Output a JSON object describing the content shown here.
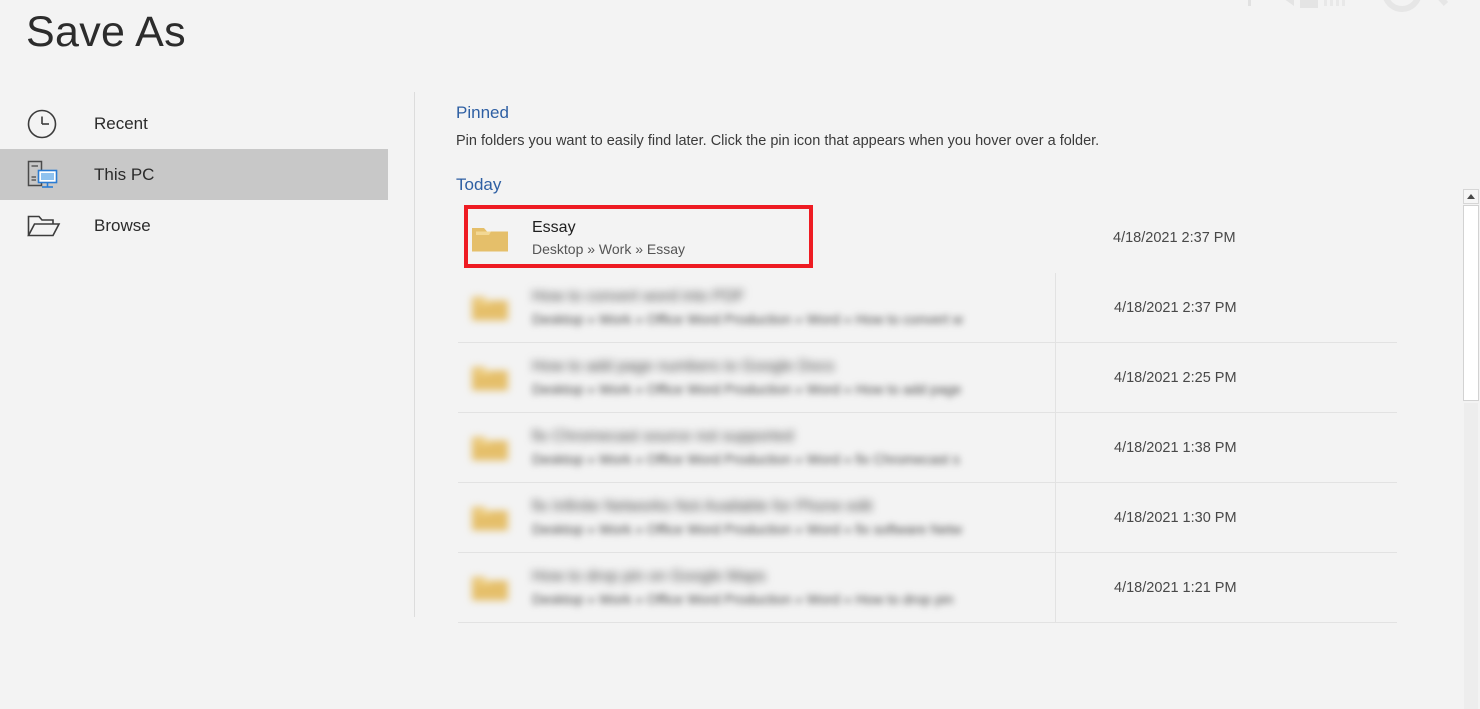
{
  "window": {
    "title": "Save As"
  },
  "topright": {
    "icons": [
      "ribbon-glyph-partial",
      "ribbon-glyph-partial-2",
      "search-glyph-partial"
    ]
  },
  "nav": {
    "items": [
      {
        "label": "Recent",
        "icon": "clock-icon",
        "selected": false
      },
      {
        "label": "This PC",
        "icon": "this-pc-icon",
        "selected": true
      },
      {
        "label": "Browse",
        "icon": "open-folder-icon",
        "selected": false
      }
    ]
  },
  "content": {
    "pinned": {
      "heading": "Pinned",
      "description": "Pin folders you want to easily find later. Click the pin icon that appears when you hover over a folder."
    },
    "today": {
      "heading": "Today"
    },
    "rows": [
      {
        "name": "Essay",
        "path": "Desktop » Work » Essay",
        "date": "4/18/2021 2:37 PM",
        "obscured": false,
        "highlighted": true
      },
      {
        "name": "How to convert word into PDF",
        "path": "Desktop » Work » Office Word Production » Word » How to convert w",
        "date": "4/18/2021 2:37 PM",
        "obscured": true,
        "highlighted": false
      },
      {
        "name": "How to add page numbers to Google Docs",
        "path": "Desktop » Work » Office Word Production » Word » How to add page",
        "date": "4/18/2021 2:25 PM",
        "obscured": true,
        "highlighted": false
      },
      {
        "name": "fix Chromecast source not supported",
        "path": "Desktop » Work » Office Word Production » Word » fix Chromecast s",
        "date": "4/18/2021 1:38 PM",
        "obscured": true,
        "highlighted": false
      },
      {
        "name": "fix Infinite Networks Not Available for Phone edit",
        "path": "Desktop » Work » Office Word Production » Word » fix software Netw",
        "date": "4/18/2021 1:30 PM",
        "obscured": true,
        "highlighted": false
      },
      {
        "name": "How to drop pin on Google Maps",
        "path": "Desktop » Work » Office Word Production » Word » How to drop pin",
        "date": "4/18/2021 1:21 PM",
        "obscured": true,
        "highlighted": false
      }
    ]
  },
  "scrollbar": {
    "up_arrow": "scroll-up-arrow",
    "position_percent": 0
  },
  "colors": {
    "background": "#f3f3f3",
    "section_heading": "#2e5fa3",
    "selected_nav": "#c8c8c8",
    "highlight_outline": "#ee1b22",
    "folder": "#e5bf6a",
    "folder_shade": "#dcb158",
    "monitor_blue": "#2b7cd3"
  }
}
